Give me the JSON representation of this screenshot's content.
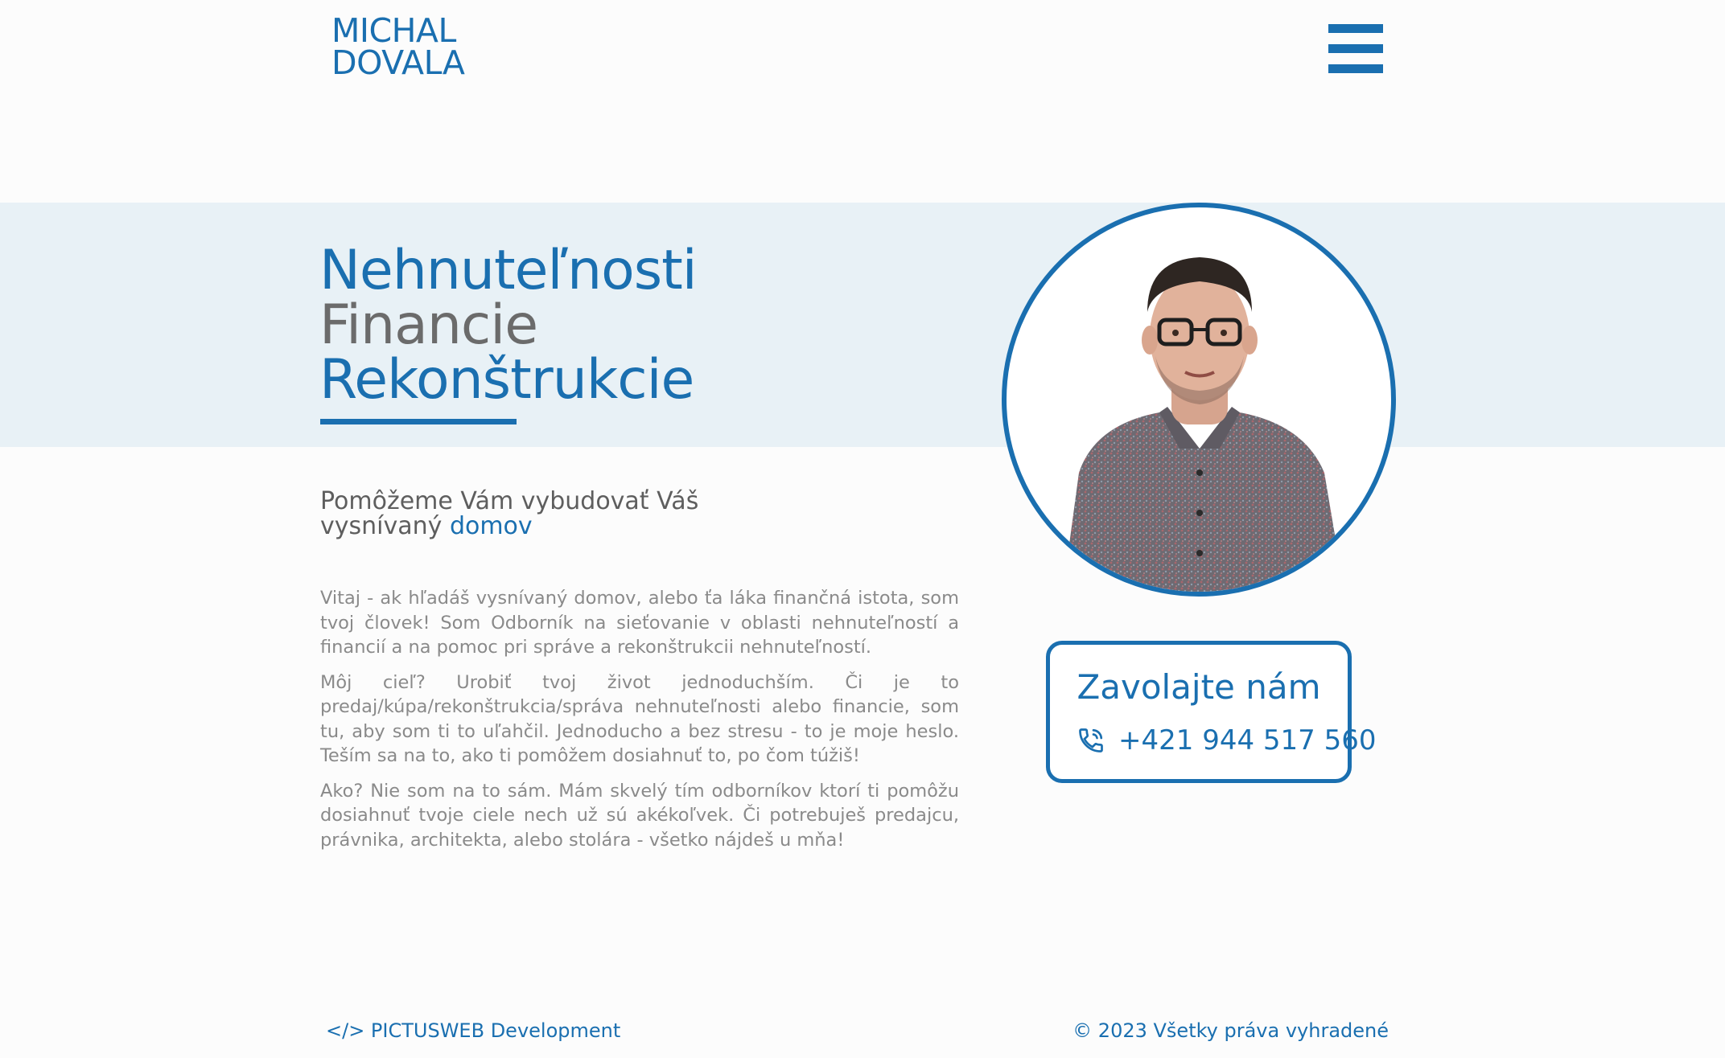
{
  "header": {
    "logo_line1": "MICHAL",
    "logo_line2": "DOVALA",
    "menu_icon": "hamburger-menu-icon"
  },
  "hero": {
    "title_line1": "Nehnuteľnosti",
    "title_line2": "Financie",
    "title_line3": "Rekonštrukcie",
    "portrait_alt": "portrait-photo"
  },
  "intro": {
    "subheading_part1": "Pomôžeme Vám vybudovať Váš",
    "subheading_part2": "vysnívaný ",
    "subheading_accent": "domov",
    "paragraphs": [
      "Vitaj - ak hľadáš vysnívaný domov, alebo ťa láka finančná istota, som tvoj človek! Som Odborník na sieťovanie v oblasti nehnuteľností a financií a na pomoc pri správe a rekonštrukcii nehnuteľností.",
      "Môj cieľ? Urobiť tvoj život jednoduchším. Či je to predaj/kúpa/rekonštrukcia/správa nehnuteľnosti alebo financie, som tu, aby som ti to uľahčil. Jednoducho a bez stresu - to je moje heslo. Teším sa na to, ako ti pomôžem dosiahnuť to, po čom túžiš!",
      "Ako? Nie som na to sám. Mám skvelý tím odborníkov ktorí ti pomôžu dosiahnuť tvoje ciele nech už sú akékoľvek. Či potrebuješ predajcu, právnika, architekta, alebo stolára - všetko nájdeš u mňa!"
    ]
  },
  "call": {
    "label": "Zavolajte nám",
    "phone": "+421 944 517 560",
    "phone_icon": "phone-icon"
  },
  "footer": {
    "credit": "</> PICTUSWEB Development",
    "copyright": "© 2023 Všetky práva vyhradené"
  },
  "colors": {
    "accent": "#1a6fb0",
    "band": "#e8f1f6",
    "text": "#8a8a8a"
  }
}
